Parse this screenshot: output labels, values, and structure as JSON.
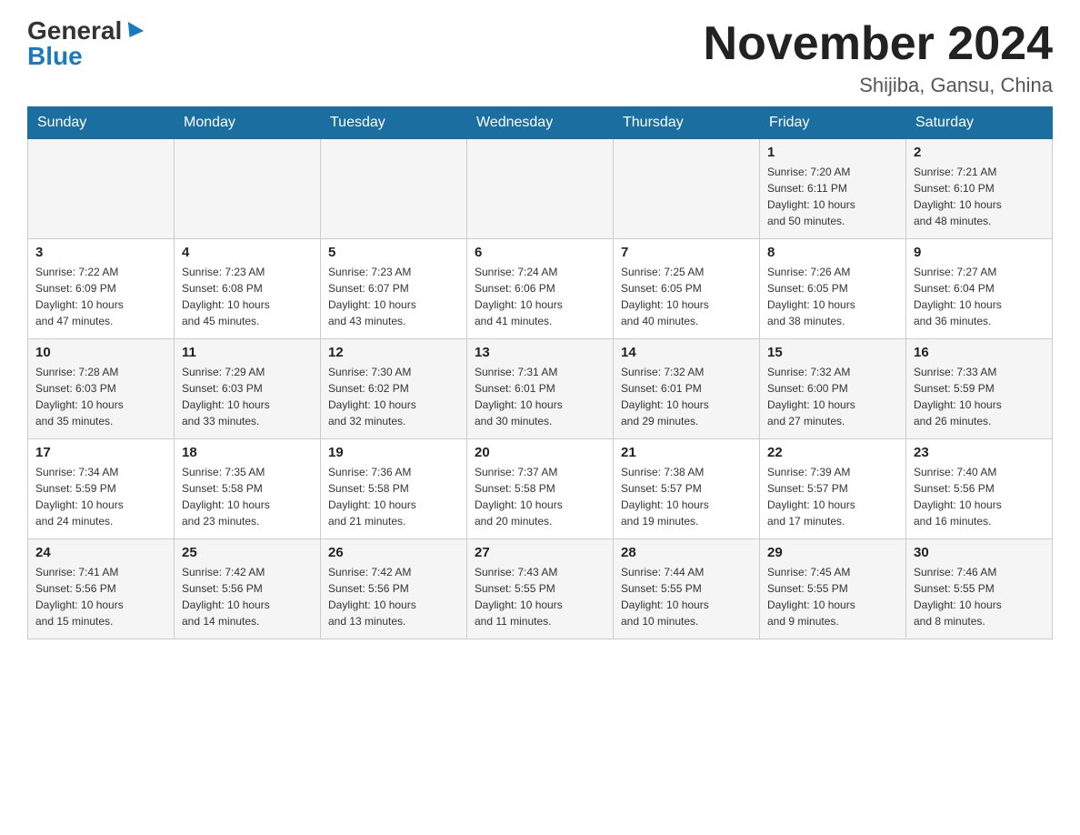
{
  "header": {
    "logo_general": "General",
    "logo_blue": "Blue",
    "title": "November 2024",
    "location": "Shijiba, Gansu, China"
  },
  "days_of_week": [
    "Sunday",
    "Monday",
    "Tuesday",
    "Wednesday",
    "Thursday",
    "Friday",
    "Saturday"
  ],
  "weeks": [
    [
      {
        "day": "",
        "info": ""
      },
      {
        "day": "",
        "info": ""
      },
      {
        "day": "",
        "info": ""
      },
      {
        "day": "",
        "info": ""
      },
      {
        "day": "",
        "info": ""
      },
      {
        "day": "1",
        "info": "Sunrise: 7:20 AM\nSunset: 6:11 PM\nDaylight: 10 hours\nand 50 minutes."
      },
      {
        "day": "2",
        "info": "Sunrise: 7:21 AM\nSunset: 6:10 PM\nDaylight: 10 hours\nand 48 minutes."
      }
    ],
    [
      {
        "day": "3",
        "info": "Sunrise: 7:22 AM\nSunset: 6:09 PM\nDaylight: 10 hours\nand 47 minutes."
      },
      {
        "day": "4",
        "info": "Sunrise: 7:23 AM\nSunset: 6:08 PM\nDaylight: 10 hours\nand 45 minutes."
      },
      {
        "day": "5",
        "info": "Sunrise: 7:23 AM\nSunset: 6:07 PM\nDaylight: 10 hours\nand 43 minutes."
      },
      {
        "day": "6",
        "info": "Sunrise: 7:24 AM\nSunset: 6:06 PM\nDaylight: 10 hours\nand 41 minutes."
      },
      {
        "day": "7",
        "info": "Sunrise: 7:25 AM\nSunset: 6:05 PM\nDaylight: 10 hours\nand 40 minutes."
      },
      {
        "day": "8",
        "info": "Sunrise: 7:26 AM\nSunset: 6:05 PM\nDaylight: 10 hours\nand 38 minutes."
      },
      {
        "day": "9",
        "info": "Sunrise: 7:27 AM\nSunset: 6:04 PM\nDaylight: 10 hours\nand 36 minutes."
      }
    ],
    [
      {
        "day": "10",
        "info": "Sunrise: 7:28 AM\nSunset: 6:03 PM\nDaylight: 10 hours\nand 35 minutes."
      },
      {
        "day": "11",
        "info": "Sunrise: 7:29 AM\nSunset: 6:03 PM\nDaylight: 10 hours\nand 33 minutes."
      },
      {
        "day": "12",
        "info": "Sunrise: 7:30 AM\nSunset: 6:02 PM\nDaylight: 10 hours\nand 32 minutes."
      },
      {
        "day": "13",
        "info": "Sunrise: 7:31 AM\nSunset: 6:01 PM\nDaylight: 10 hours\nand 30 minutes."
      },
      {
        "day": "14",
        "info": "Sunrise: 7:32 AM\nSunset: 6:01 PM\nDaylight: 10 hours\nand 29 minutes."
      },
      {
        "day": "15",
        "info": "Sunrise: 7:32 AM\nSunset: 6:00 PM\nDaylight: 10 hours\nand 27 minutes."
      },
      {
        "day": "16",
        "info": "Sunrise: 7:33 AM\nSunset: 5:59 PM\nDaylight: 10 hours\nand 26 minutes."
      }
    ],
    [
      {
        "day": "17",
        "info": "Sunrise: 7:34 AM\nSunset: 5:59 PM\nDaylight: 10 hours\nand 24 minutes."
      },
      {
        "day": "18",
        "info": "Sunrise: 7:35 AM\nSunset: 5:58 PM\nDaylight: 10 hours\nand 23 minutes."
      },
      {
        "day": "19",
        "info": "Sunrise: 7:36 AM\nSunset: 5:58 PM\nDaylight: 10 hours\nand 21 minutes."
      },
      {
        "day": "20",
        "info": "Sunrise: 7:37 AM\nSunset: 5:58 PM\nDaylight: 10 hours\nand 20 minutes."
      },
      {
        "day": "21",
        "info": "Sunrise: 7:38 AM\nSunset: 5:57 PM\nDaylight: 10 hours\nand 19 minutes."
      },
      {
        "day": "22",
        "info": "Sunrise: 7:39 AM\nSunset: 5:57 PM\nDaylight: 10 hours\nand 17 minutes."
      },
      {
        "day": "23",
        "info": "Sunrise: 7:40 AM\nSunset: 5:56 PM\nDaylight: 10 hours\nand 16 minutes."
      }
    ],
    [
      {
        "day": "24",
        "info": "Sunrise: 7:41 AM\nSunset: 5:56 PM\nDaylight: 10 hours\nand 15 minutes."
      },
      {
        "day": "25",
        "info": "Sunrise: 7:42 AM\nSunset: 5:56 PM\nDaylight: 10 hours\nand 14 minutes."
      },
      {
        "day": "26",
        "info": "Sunrise: 7:42 AM\nSunset: 5:56 PM\nDaylight: 10 hours\nand 13 minutes."
      },
      {
        "day": "27",
        "info": "Sunrise: 7:43 AM\nSunset: 5:55 PM\nDaylight: 10 hours\nand 11 minutes."
      },
      {
        "day": "28",
        "info": "Sunrise: 7:44 AM\nSunset: 5:55 PM\nDaylight: 10 hours\nand 10 minutes."
      },
      {
        "day": "29",
        "info": "Sunrise: 7:45 AM\nSunset: 5:55 PM\nDaylight: 10 hours\nand 9 minutes."
      },
      {
        "day": "30",
        "info": "Sunrise: 7:46 AM\nSunset: 5:55 PM\nDaylight: 10 hours\nand 8 minutes."
      }
    ]
  ]
}
